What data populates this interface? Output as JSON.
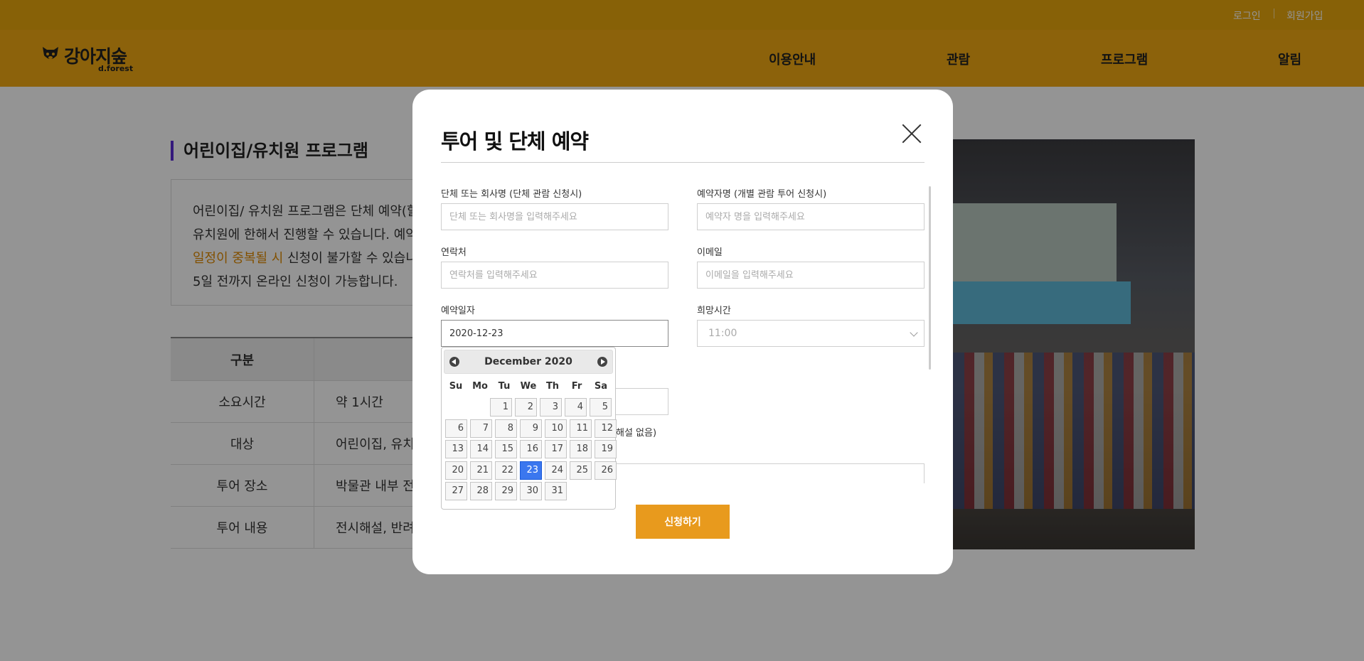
{
  "header": {
    "login": "로그인",
    "signup": "회원가입",
    "logo_name": "강아지숲",
    "logo_sub": "d.forest",
    "menu": [
      "이용안내",
      "관람",
      "프로그램",
      "알림"
    ]
  },
  "page": {
    "section_title": "어린이집/유치원 프로그램",
    "intro_line1": "어린이집/ 유치원 프로그램은 단체 예약(할",
    "intro_line2": "유치원에 한해서 진행할 수 있습니다. 예약",
    "intro_highlight": "일정이 중복될 시",
    "intro_line3_rest": " 신청이 불가할 수 있습니다",
    "intro_line4": "5일 전까지 온라인 신청이 가능합니다.",
    "table": {
      "header": "구분",
      "rows": [
        {
          "label": "소요시간",
          "value": "약 1시간"
        },
        {
          "label": "대상",
          "value": "어린이집, 유치"
        },
        {
          "label": "투어 장소",
          "value": "박물관 내부 전"
        },
        {
          "label": "투어 내용",
          "value": "전시해설, 반려"
        }
      ]
    }
  },
  "modal": {
    "title": "투어 및 단체 예약",
    "group_name_label": "단체 또는 회사명 (단체 관람 신청시)",
    "group_name_placeholder": "단체 또는 회사명을 입력해주세요",
    "reserver_label": "예약자명 (개별 관람 투어 신청시)",
    "reserver_placeholder": "예약자 명을 입력해주세요",
    "contact_label": "연락처",
    "contact_placeholder": "연락처를 입력해주세요",
    "email_label": "이메일",
    "email_placeholder": "이메일을 입력해주세요",
    "date_label": "예약일자",
    "date_value": "2020-12-23",
    "time_label": "희망시간",
    "time_value": "11:00",
    "partial_option_text": "해설 없음)",
    "submit_label": "신청하기"
  },
  "datepicker": {
    "month_label": "December 2020",
    "dow": [
      "Su",
      "Mo",
      "Tu",
      "We",
      "Th",
      "Fr",
      "Sa"
    ],
    "selected_day": 23,
    "weeks": [
      [
        "",
        "",
        "1",
        "2",
        "3",
        "4",
        "5"
      ],
      [
        "6",
        "7",
        "8",
        "9",
        "10",
        "11",
        "12"
      ],
      [
        "13",
        "14",
        "15",
        "16",
        "17",
        "18",
        "19"
      ],
      [
        "20",
        "21",
        "22",
        "23",
        "24",
        "25",
        "26"
      ],
      [
        "27",
        "28",
        "29",
        "30",
        "31",
        "",
        ""
      ]
    ]
  },
  "colors": {
    "topbar": "#e8a80d",
    "navbar": "#f1a913",
    "accent": "#e89a1d",
    "highlight_text": "#e08a00",
    "selected_day": "#3b77ef",
    "section_bar": "#5b2bd6"
  }
}
